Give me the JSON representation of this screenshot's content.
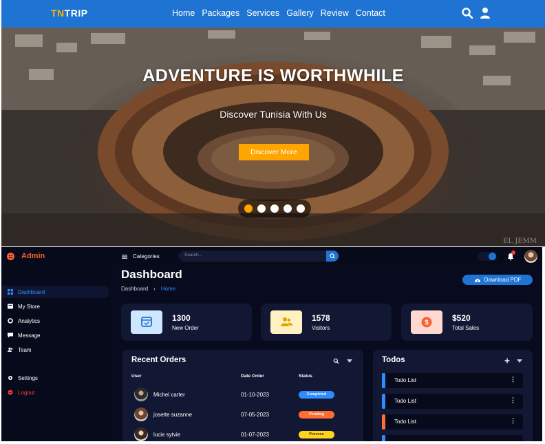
{
  "site": {
    "logo_a": "TN",
    "logo_b": "TRIP",
    "nav": [
      "Home",
      "Packages",
      "Services",
      "Gallery",
      "Review",
      "Contact"
    ],
    "hero_title": "ADVENTURE IS WORTHWHILE",
    "hero_subtitle": "Discover Tunisia With Us",
    "hero_button": "Discover More",
    "watermark": "EL JEMM",
    "slide_count": 5,
    "active_slide": 1,
    "colors": {
      "nav": "#1f74d3",
      "accent": "#ffa500"
    },
    "icons": [
      "search-icon",
      "user-icon"
    ]
  },
  "admin": {
    "brand": "Admin",
    "categories_label": "Categories",
    "search_placeholder": "Search...",
    "sidebar": [
      {
        "label": "Dashboard",
        "icon": "grid-icon",
        "active": true
      },
      {
        "label": "My Store",
        "icon": "store-icon"
      },
      {
        "label": "Analytics",
        "icon": "analytics-icon"
      },
      {
        "label": "Message",
        "icon": "message-icon"
      },
      {
        "label": "Team",
        "icon": "team-icon"
      },
      {
        "label": "Settings",
        "icon": "gear-icon"
      },
      {
        "label": "Logout",
        "icon": "logout-icon"
      }
    ],
    "title": "Dashboard",
    "breadcrumb": [
      "Dashboard",
      "Home"
    ],
    "download_button": "Download PDF",
    "stats": [
      {
        "value": "1300",
        "label": "New Order",
        "icon": "calendar-check-icon",
        "color": "#cfe6ff"
      },
      {
        "value": "1578",
        "label": "Visitors",
        "icon": "people-icon",
        "color": "#fff1c2"
      },
      {
        "value": "$520",
        "label": "Total Sales",
        "icon": "dollar-icon",
        "color": "#ffd9cf"
      }
    ],
    "orders": {
      "title": "Recent Orders",
      "headers": [
        "User",
        "Date Order",
        "Status"
      ],
      "rows": [
        {
          "user": "Michel carter",
          "date": "01-10-2023",
          "status": "Completed",
          "color": "#2d8cff"
        },
        {
          "user": "josette suzanne",
          "date": "07-05-2023",
          "status": "Pending",
          "color": "#ff6d33"
        },
        {
          "user": "lucie sytvie",
          "date": "01-07-2023",
          "status": "Process",
          "color": "#ffd41c"
        }
      ]
    },
    "todos": {
      "title": "Todos",
      "items": [
        {
          "label": "Todo List",
          "color": "#2d8cff"
        },
        {
          "label": "Todo List",
          "color": "#2d8cff"
        },
        {
          "label": "Todo List",
          "color": "#ff6d33"
        }
      ]
    }
  }
}
